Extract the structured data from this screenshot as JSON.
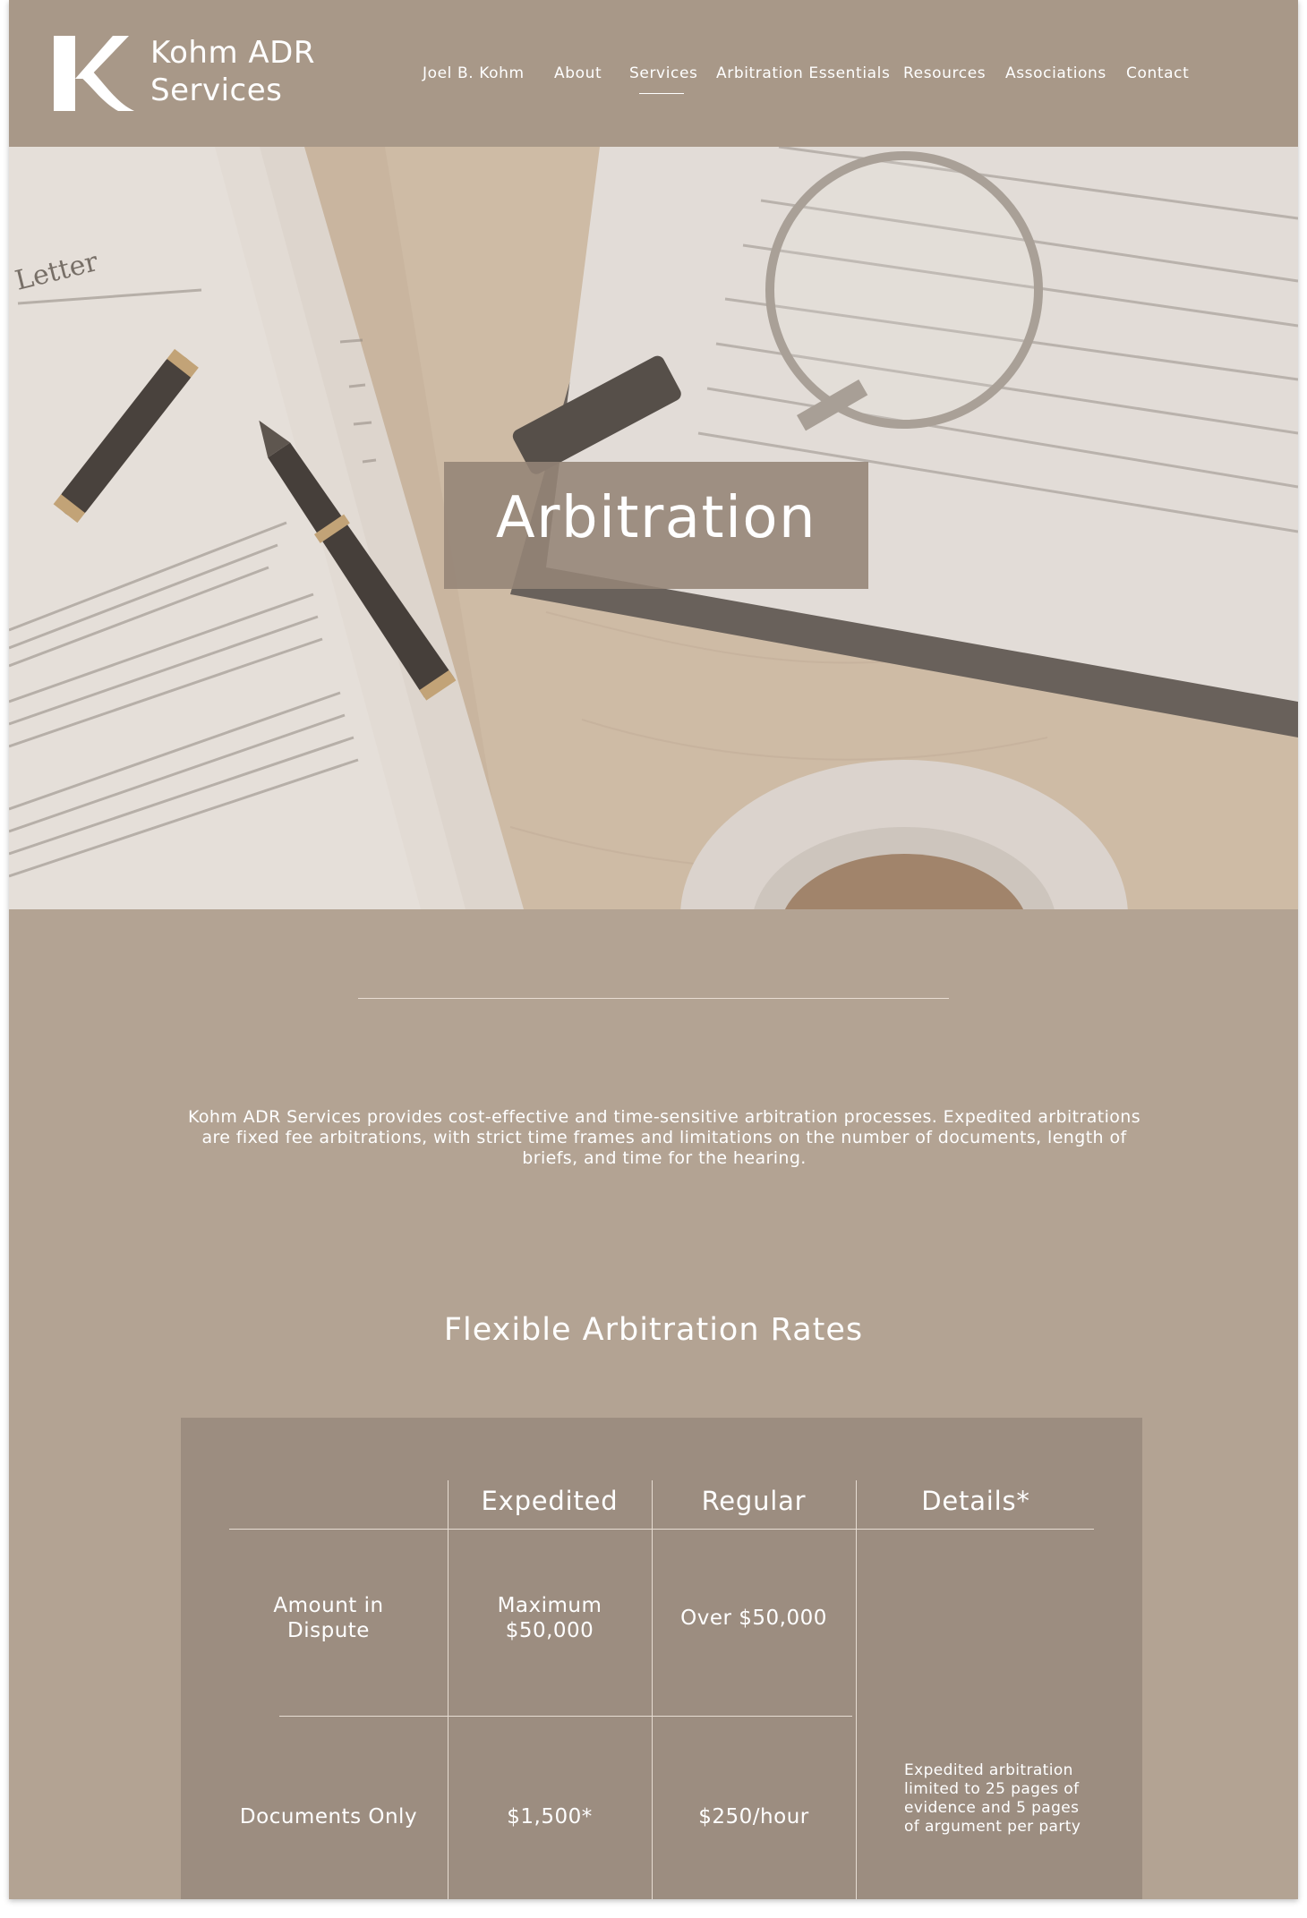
{
  "brand": {
    "logo_letter": "K",
    "name_line1": "Kohm ADR",
    "name_line2": "Services"
  },
  "nav": {
    "items": [
      {
        "label": "Joel B. Kohm"
      },
      {
        "label": "About"
      },
      {
        "label": "Services",
        "active": true
      },
      {
        "label": "Arbitration Essentials"
      },
      {
        "label": "Resources"
      },
      {
        "label": "Associations"
      },
      {
        "label": "Contact"
      }
    ]
  },
  "hero": {
    "title": "Arbitration"
  },
  "intro": {
    "text": "Kohm ADR Services provides cost-effective and time-sensitive arbitration processes. Expedited arbitrations are fixed fee arbitrations, with strict time frames and limitations on the number of documents, length of briefs, and time for the hearing."
  },
  "rates": {
    "title": "Flexible Arbitration Rates",
    "headers": [
      "Expedited",
      "Regular",
      "Details*"
    ],
    "rows": [
      {
        "label": "Amount in Dispute",
        "expedited": "Maximum $50,000",
        "regular": "Over $50,000"
      },
      {
        "label": "Documents Only",
        "expedited": "$1,500*",
        "regular": "$250/hour"
      }
    ],
    "details_note": "Expedited arbitration limited to 25 pages of evidence and 5 pages of argument per party"
  },
  "colors": {
    "header_bg": "#a89888",
    "page_bg": "#b3a393",
    "table_bg": "#9c8d80",
    "text": "#ffffff"
  }
}
